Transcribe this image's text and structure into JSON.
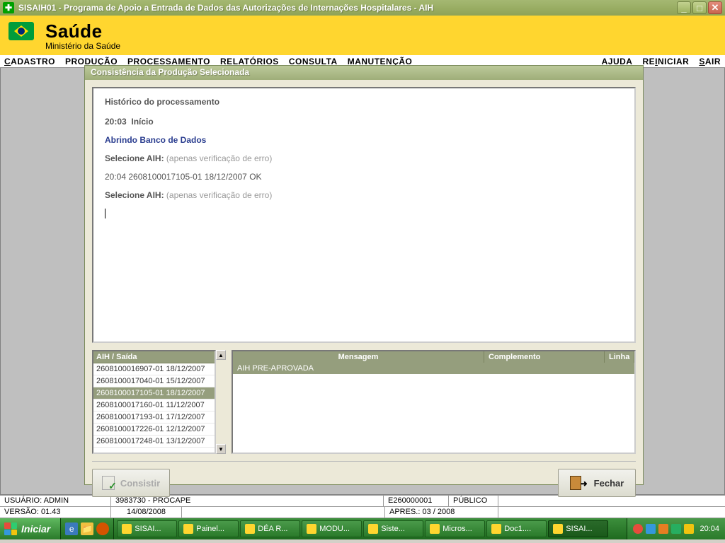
{
  "titlebar": {
    "text": "SISAIH01 - Programa de Apoio a Entrada de Dados das Autorizações de Internações Hospitalares - AIH"
  },
  "header": {
    "saude": "Saúde",
    "ministerio": "Ministério da Saúde"
  },
  "menu": {
    "cadastro": "CADASTRO",
    "producao": "PRODUÇÃO",
    "processamento": "PROCESSAMENTO",
    "relatorios": "RELATÓRIOS",
    "consulta": "CONSULTA",
    "manutencao": "MANUTENÇÃO",
    "ajuda": "AJUDA",
    "reiniciar": "REINICIAR",
    "sair": "SAIR"
  },
  "dialog": {
    "title": "Consistência da Produção Selecionada",
    "log": {
      "label": "Histórico do processamento",
      "l1_time": "20:03",
      "l1_text": "Início",
      "l2": "Abrindo Banco de Dados",
      "l3_label": "Selecione AIH:",
      "l3_paren": "(apenas verificação de erro)",
      "l4": "20:04  2608100017105-01 18/12/2007  OK",
      "l5_label": "Selecione AIH:",
      "l5_paren": "(apenas verificação de erro)"
    },
    "list": {
      "header": "AIH / Saída",
      "items": [
        "2608100016907-01 18/12/2007",
        "2608100017040-01 15/12/2007",
        "2608100017105-01 18/12/2007",
        "2608100017160-01 11/12/2007",
        "2608100017193-01 17/12/2007",
        "2608100017226-01 12/12/2007",
        "2608100017248-01 13/12/2007"
      ],
      "selected_index": 2
    },
    "msg": {
      "col_mensagem": "Mensagem",
      "col_complemento": "Complemento",
      "col_linha": "Linha",
      "row1": "AIH PRE-APROVADA"
    },
    "buttons": {
      "consistir": "Consistir",
      "fechar": "Fechar"
    }
  },
  "status": {
    "usuario_label": "USUÁRIO: ADMIN",
    "estab": "3983730 - PROCAPE",
    "cnes": "E260000001",
    "publico": "PÚBLICO",
    "versao_label": "VERSÃO: 01.43",
    "data": "14/08/2008",
    "apres": "APRES.: 03 / 2008"
  },
  "taskbar": {
    "start": "Iniciar",
    "items": [
      {
        "label": "SISAI..."
      },
      {
        "label": "Painel..."
      },
      {
        "label": "DÉA R..."
      },
      {
        "label": "MODU..."
      },
      {
        "label": "Siste..."
      },
      {
        "label": "Micros..."
      },
      {
        "label": "Doc1...."
      },
      {
        "label": "SISAI..."
      }
    ],
    "time": "20:04"
  }
}
